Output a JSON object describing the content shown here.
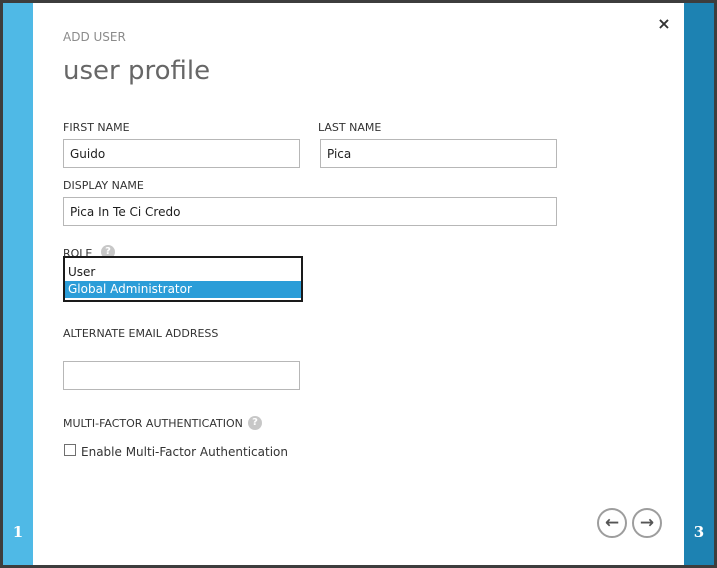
{
  "wizard": {
    "subtitle": "ADD USER",
    "title": "user profile",
    "current_step": "1",
    "next_step": "3",
    "close_glyph": "×"
  },
  "form": {
    "first_name": {
      "label": "FIRST NAME",
      "value": "Guido"
    },
    "last_name": {
      "label": "LAST NAME",
      "value": "Pica"
    },
    "display_name": {
      "label": "DISPLAY NAME",
      "value": "Pica In Te Ci Credo"
    },
    "role": {
      "label": "ROLE",
      "options": [
        "User",
        "Global Administrator"
      ],
      "selected": "Global Administrator"
    },
    "alternate_email": {
      "label": "ALTERNATE EMAIL ADDRESS",
      "value": ""
    },
    "mfa": {
      "label": "MULTI-FACTOR AUTHENTICATION",
      "checkbox_label": "Enable Multi-Factor Authentication",
      "checked": false
    }
  },
  "icons": {
    "help": "?",
    "back": "←",
    "next": "→"
  },
  "colors": {
    "left_bar": "#4fb9e6",
    "right_bar": "#1d82b2",
    "selection": "#2b9dd8"
  }
}
